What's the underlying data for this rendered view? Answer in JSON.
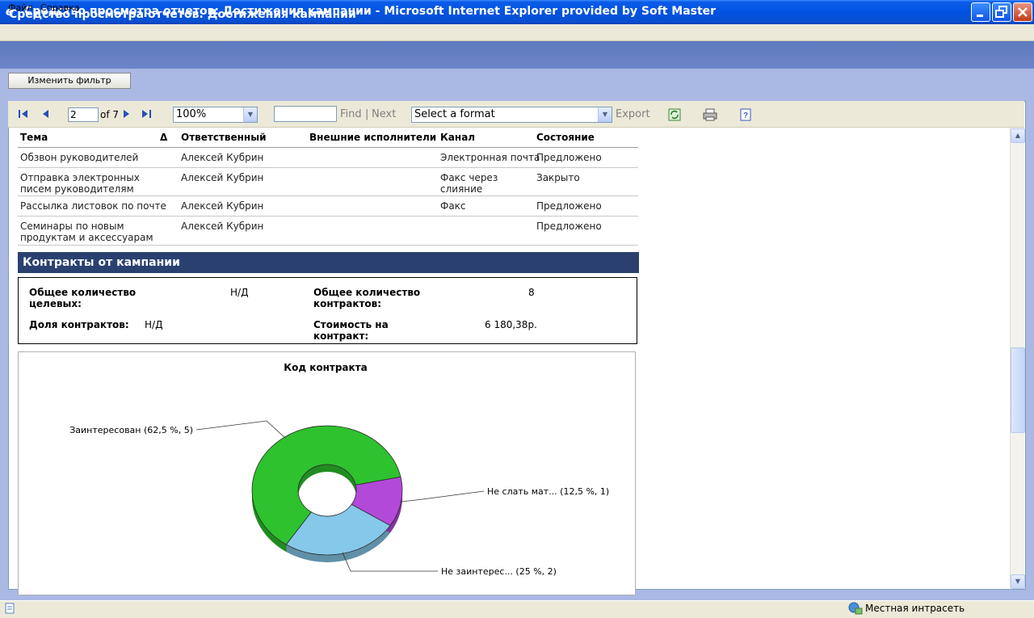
{
  "window": {
    "title": "Средство просмотра отчетов: Достижения кампании - Microsoft Internet Explorer provided by Soft Master",
    "icon": "ie-icon"
  },
  "menu": {
    "items": [
      "Файл",
      "Справка"
    ]
  },
  "report": {
    "title": "Средство просмотра отчетов: Достижения кампании",
    "filter_button": "Изменить фильтр"
  },
  "toolbar": {
    "page": "2",
    "of_pages": "of 7",
    "zoom": "100%",
    "find_placeholder": "",
    "find_label": "Find",
    "separator": "|",
    "next_label": "Next",
    "format_select": "Select a format",
    "export_label": "Export"
  },
  "table": {
    "headers": [
      "Тема",
      "Δ",
      "Ответственный",
      "Внешние исполнители",
      "Канал",
      "Состояние"
    ],
    "rows": [
      {
        "topic": [
          "Обзвон руководителей"
        ],
        "owner": "Алексей Кубрин",
        "external": "",
        "channel": [
          "Электронная почта"
        ],
        "state": "Предложено"
      },
      {
        "topic": [
          "Отправка электронных",
          "писем руководителям"
        ],
        "owner": "Алексей Кубрин",
        "external": "",
        "channel": [
          "Факс через",
          "слияние"
        ],
        "state": "Закрыто"
      },
      {
        "topic": [
          "Рассылка листовок по почте"
        ],
        "owner": "Алексей Кубрин",
        "external": "",
        "channel": [
          "Факс"
        ],
        "state": "Предложено"
      },
      {
        "topic": [
          "Семинары по новым",
          "продуктам и аксессуарам"
        ],
        "owner": "Алексей Кубрин",
        "external": "",
        "channel": [
          ""
        ],
        "state": "Предложено"
      }
    ]
  },
  "contracts": {
    "section_title": "Контракты от кампании",
    "total_targets_label": [
      "Общее количество",
      "целевых:"
    ],
    "total_targets_value": "Н/Д",
    "total_contracts_label": [
      "Общее количество",
      "контрактов:"
    ],
    "total_contracts_value": "8",
    "share_label": "Доля контрактов:",
    "share_value": "Н/Д",
    "cost_label": [
      "Стоимость на",
      "контракт:"
    ],
    "cost_value": "6 180,38р."
  },
  "chart_data": {
    "type": "pie",
    "style": "doughnut-3d",
    "title": "Код контракта",
    "slices": [
      {
        "label": "Заинтересован (62,5 %, 5)",
        "value": 5,
        "percent": 62.5,
        "color": "#2ec22e"
      },
      {
        "label": "Не слать мат... (12,5 %, 1)",
        "value": 1,
        "percent": 12.5,
        "color": "#b349d8"
      },
      {
        "label": "Не заинтерес... (25 %, 2)",
        "value": 2,
        "percent": 25,
        "color": "#86c8ea"
      }
    ]
  },
  "statusbar": {
    "zone": "Местная интрасеть"
  }
}
